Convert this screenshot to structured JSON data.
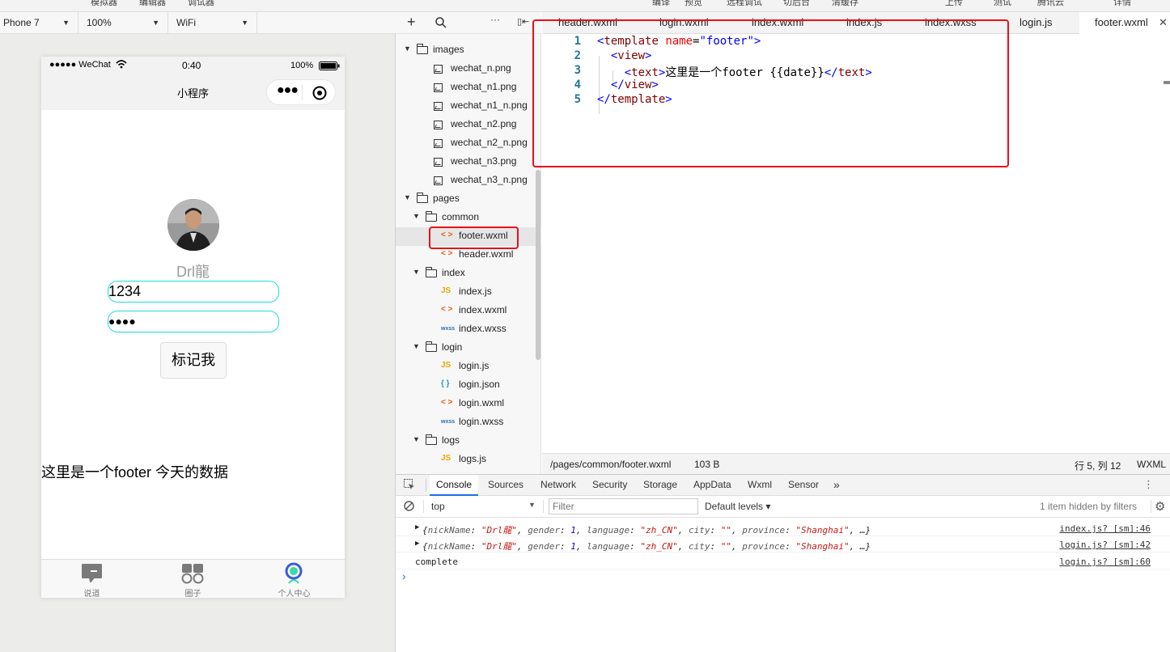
{
  "topbar": {
    "items": [
      "模拟器",
      "编辑器",
      "调试器",
      "编译",
      "预览",
      "远程调试",
      "切后台",
      "清缓存",
      "上传",
      "测试",
      "腾讯云",
      "详情"
    ]
  },
  "simulator": {
    "device": "Phone 7",
    "zoom": "100%",
    "network": "WiFi",
    "status_bar": {
      "carrier": "●●●●● WeChat",
      "time": "0:40",
      "battery": "100%"
    },
    "nav_title": "小程序",
    "page": {
      "nickname": "Drl龍",
      "username_value": "1234",
      "password_value": "●●●●",
      "mark_button": "标记我",
      "footer_text": "这里是一个footer 今天的数据"
    },
    "tabbar": [
      {
        "label": "说道",
        "icon": "chat-icon"
      },
      {
        "label": "圈子",
        "icon": "grid-icon"
      },
      {
        "label": "个人中心",
        "icon": "profile-icon"
      }
    ]
  },
  "file_tree": {
    "rows": [
      {
        "type": "folder",
        "name": "images",
        "level": 0
      },
      {
        "type": "image",
        "name": "wechat_n.png",
        "level": 1
      },
      {
        "type": "image",
        "name": "wechat_n1.png",
        "level": 1
      },
      {
        "type": "image",
        "name": "wechat_n1_n.png",
        "level": 1
      },
      {
        "type": "image",
        "name": "wechat_n2.png",
        "level": 1
      },
      {
        "type": "image",
        "name": "wechat_n2_n.png",
        "level": 1
      },
      {
        "type": "image",
        "name": "wechat_n3.png",
        "level": 1
      },
      {
        "type": "image",
        "name": "wechat_n3_n.png",
        "level": 1
      },
      {
        "type": "folder",
        "name": "pages",
        "level": 0
      },
      {
        "type": "folder",
        "name": "common",
        "level": 1
      },
      {
        "type": "wxml",
        "name": "footer.wxml",
        "level": 2,
        "selected": true
      },
      {
        "type": "wxml",
        "name": "header.wxml",
        "level": 2
      },
      {
        "type": "folder",
        "name": "index",
        "level": 1
      },
      {
        "type": "js",
        "name": "index.js",
        "level": 2
      },
      {
        "type": "wxml",
        "name": "index.wxml",
        "level": 2
      },
      {
        "type": "wxss",
        "name": "index.wxss",
        "level": 2
      },
      {
        "type": "folder",
        "name": "login",
        "level": 1
      },
      {
        "type": "js",
        "name": "login.js",
        "level": 2
      },
      {
        "type": "json",
        "name": "login.json",
        "level": 2
      },
      {
        "type": "wxml",
        "name": "login.wxml",
        "level": 2
      },
      {
        "type": "wxss",
        "name": "login.wxss",
        "level": 2
      },
      {
        "type": "folder",
        "name": "logs",
        "level": 1
      },
      {
        "type": "js",
        "name": "logs.js",
        "level": 2
      }
    ],
    "icon_glyphs": {
      "js": "JS",
      "wxml": "< >",
      "wxss": "wxss",
      "json": "{ }"
    },
    "colors": {
      "js": "#e6a800",
      "wxml": "#e8590c",
      "wxss": "#2b6cb0",
      "json": "#1a9ec9"
    }
  },
  "editor": {
    "tabs": [
      "header.wxml",
      "login.wxml",
      "index.wxml",
      "index.js",
      "index.wxss",
      "login.js",
      "footer.wxml"
    ],
    "active_tab": "footer.wxml",
    "lines": [
      {
        "n": "1",
        "text": "<template name=\"footer\">"
      },
      {
        "n": "2",
        "text": "  <view>"
      },
      {
        "n": "3",
        "text": "    <text>这里是一个footer {{date}}</text>"
      },
      {
        "n": "4",
        "text": "  </view>"
      },
      {
        "n": "5",
        "text": "</template>"
      }
    ],
    "status": {
      "path": "/pages/common/footer.wxml",
      "size": "103 B",
      "cursor": "行 5, 列 12",
      "lang": "WXML"
    }
  },
  "devtools": {
    "tabs": [
      "Console",
      "Sources",
      "Network",
      "Security",
      "Storage",
      "AppData",
      "Wxml",
      "Sensor",
      "»"
    ],
    "active_tab": "Console",
    "context": "top",
    "filter_placeholder": "Filter",
    "levels": "Default levels ▾",
    "hidden_info": "1 item hidden by filters",
    "logs": [
      {
        "text": "{nickName: \"Drl龍\", gender: 1, language: \"zh_CN\", city: \"\", province: \"Shanghai\", …}",
        "src": "index.js? [sm]:46",
        "expandable": true
      },
      {
        "text": "{nickName: \"Drl龍\", gender: 1, language: \"zh_CN\", city: \"\", province: \"Shanghai\", …}",
        "src": "login.js? [sm]:42",
        "expandable": true
      },
      {
        "text": "complete",
        "src": "login.js? [sm]:60",
        "expandable": false
      }
    ],
    "prompt": "›"
  },
  "colors": {
    "highlight_red": "#e8101b",
    "input_border": "#19e0d8",
    "active_tab_underline": "#1a73e8"
  }
}
